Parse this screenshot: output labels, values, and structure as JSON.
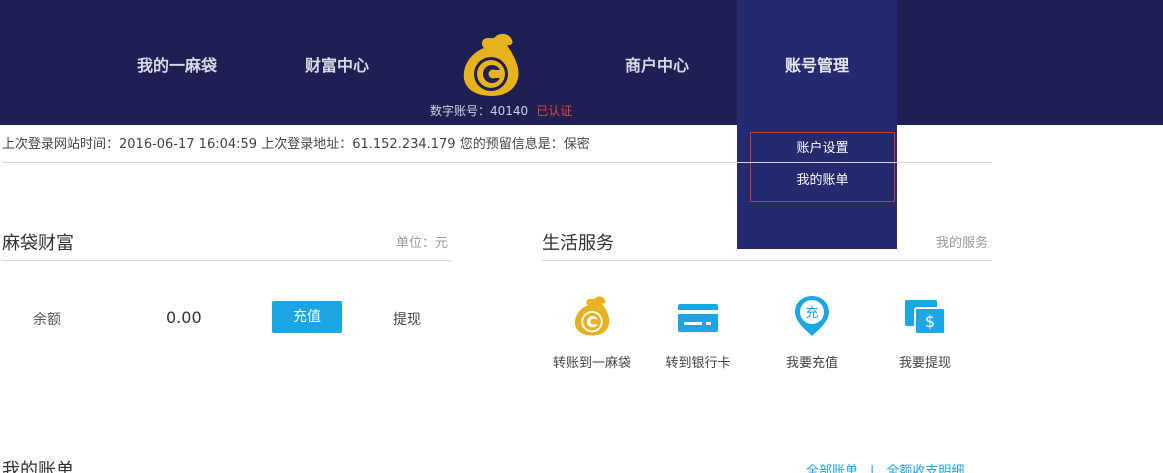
{
  "nav": {
    "items": [
      {
        "label": "我的一麻袋"
      },
      {
        "label": "财富中心"
      },
      {
        "label": "商户中心"
      },
      {
        "label": "账号管理"
      }
    ],
    "account_prefix": "数字账号：",
    "account_number": "40140",
    "verified": "已认证",
    "dropdown": [
      "账户设置",
      "我的账单"
    ]
  },
  "login_info": "上次登录网站时间：2016-06-17 16:04:59 上次登录地址：61.152.234.179 您的预留信息是：保密",
  "wealth": {
    "title": "麻袋财富",
    "unit": "单位：元",
    "balance_label": "余额",
    "balance_value": "0.00",
    "recharge_label": "充值",
    "withdraw_label": "提现"
  },
  "services": {
    "title": "生活服务",
    "link": "我的服务",
    "items": [
      {
        "label": "转账到一麻袋",
        "icon": "bag-logo-icon"
      },
      {
        "label": "转到银行卡",
        "icon": "bank-card-icon"
      },
      {
        "label": "我要充值",
        "icon": "recharge-pin-icon"
      },
      {
        "label": "我要提现",
        "icon": "withdraw-dollar-icon"
      }
    ]
  },
  "bills": {
    "title": "我的账单",
    "all_label": "全部账单",
    "detail_label": "全额收支明细"
  },
  "colors": {
    "header_bg": "#1e1f52",
    "header_active": "#252a6e",
    "accent_blue": "#1ca6e6",
    "gold": "#e8b21f",
    "verified_red": "#e8423a"
  }
}
